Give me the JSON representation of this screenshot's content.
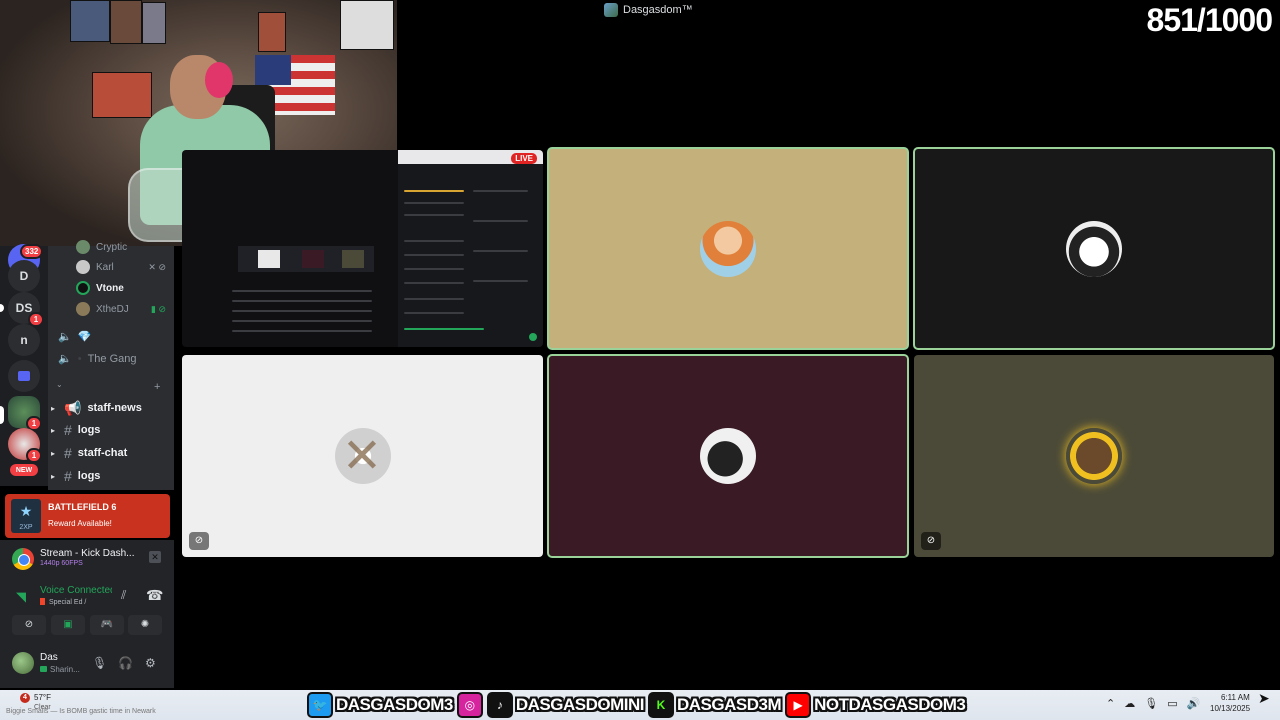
{
  "window": {
    "title": "Dasgasdom™"
  },
  "overlay": {
    "counter": "851/1000"
  },
  "server_rail": {
    "items": [
      {
        "label": "",
        "badge": "332",
        "icon": "home-icon"
      },
      {
        "label": "D",
        "badge": ""
      },
      {
        "label": "DS",
        "badge": "1"
      },
      {
        "label": "n",
        "badge": ""
      },
      {
        "label": "",
        "badge": "",
        "icon": "folder-icon"
      },
      {
        "label": "",
        "badge": "1",
        "icon": "server-avatar"
      },
      {
        "label": "",
        "badge": "1",
        "icon": "server-avatar"
      },
      {
        "label": "NEW",
        "badge": ""
      }
    ]
  },
  "voice_channel_users": [
    {
      "name": "Cryptic",
      "icons": ""
    },
    {
      "name": "Karl",
      "icons": "✕ ⊘"
    },
    {
      "name": "Vtone",
      "icons": ""
    },
    {
      "name": "XtheDJ",
      "icons": "▮ ⊘"
    }
  ],
  "voice_channels": [
    {
      "name": "",
      "emoji": "💎"
    },
    {
      "name": "The Gang",
      "emoji": ""
    }
  ],
  "text_channels": [
    {
      "name": "staff-news"
    },
    {
      "name": "logs"
    },
    {
      "name": "staff-chat"
    },
    {
      "name": "logs"
    }
  ],
  "promo": {
    "title": "BATTLEFIELD 6",
    "subtitle": "Reward Available!",
    "icon_text": "2XP"
  },
  "stream": {
    "title": "Stream - Kick Dash...",
    "quality": "1440p 60FPS"
  },
  "voice": {
    "status": "Voice Connected",
    "channel": "Special Ed /"
  },
  "user": {
    "name": "Das",
    "status": "Sharin..."
  },
  "video_tiles": [
    {
      "name": "screen-share",
      "bg": "#101012"
    },
    {
      "name": "participant-aang",
      "bg": "#c4b07a",
      "speaking": true,
      "muted": false
    },
    {
      "name": "participant-manga",
      "bg": "#181818",
      "speaking": true,
      "muted": false
    },
    {
      "name": "participant-default",
      "bg": "#efefef",
      "speaking": false,
      "muted": true
    },
    {
      "name": "participant-cat",
      "bg": "#3a1a24",
      "speaking": true,
      "muted": false
    },
    {
      "name": "participant-gold",
      "bg": "#4b4a38",
      "speaking": false,
      "muted": true
    }
  ],
  "screen_share": {
    "live_label": "LIVE"
  },
  "taskbar": {
    "weather_temp": "57°F",
    "weather_cond": "Clear",
    "weather_badge": "4",
    "ticker": "Biggie Smalls — Is BOMB gastic time in Newark",
    "social": [
      {
        "platform": "twitter",
        "icon_name": "twitter-icon",
        "color": "#1d9bf0",
        "handle": "DASGASDOM3"
      },
      {
        "platform": "instagram",
        "icon_name": "instagram-icon",
        "color": "#d6249f",
        "handle": ""
      },
      {
        "platform": "tiktok",
        "icon_name": "tiktok-icon",
        "color": "#111111",
        "handle": "DASGASDOMINI"
      },
      {
        "platform": "kick",
        "icon_name": "kick-icon",
        "color": "#53fc18",
        "handle": "DASGASD3M"
      },
      {
        "platform": "youtube",
        "icon_name": "youtube-icon",
        "color": "#ff0000",
        "handle": "NOTDASGASDOM3"
      }
    ],
    "clock_time": "6:11 AM",
    "clock_date": "10/13/2025"
  },
  "colors": {
    "speaking_outline": "#9ad29a",
    "discord_green": "#23a55a",
    "promo_red": "#c8321e"
  }
}
